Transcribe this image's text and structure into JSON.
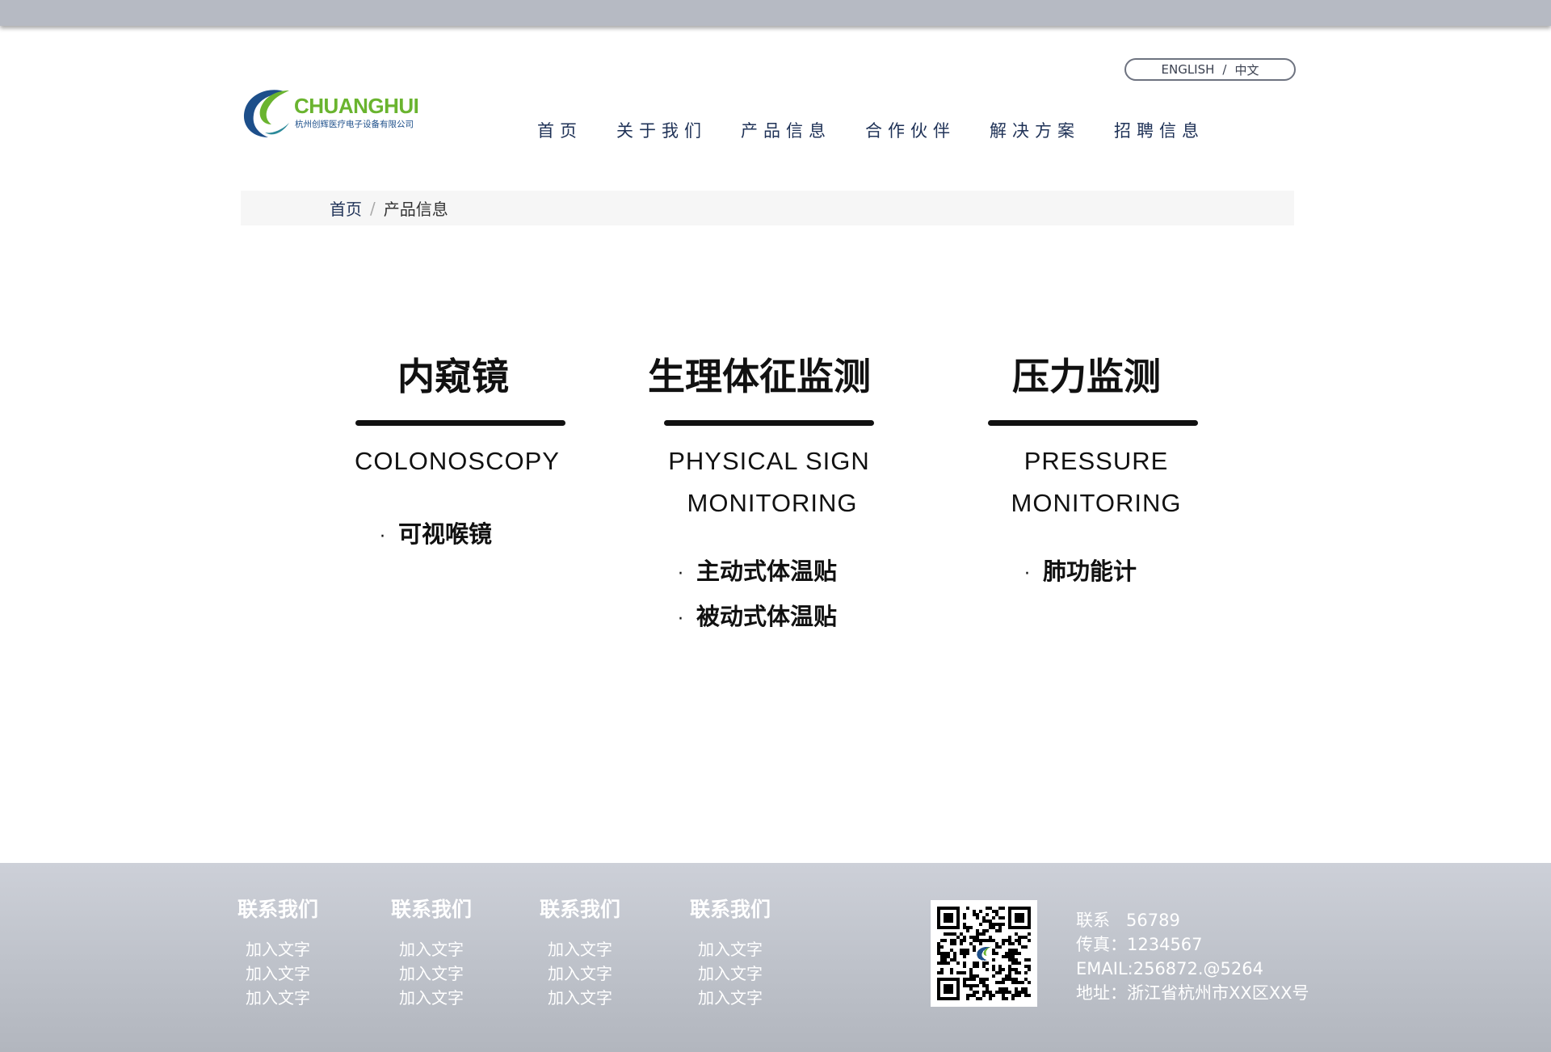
{
  "language_switch": {
    "english": "ENGLISH",
    "separator": "/",
    "chinese": "中文"
  },
  "logo": {
    "name": "CHUANGHUI",
    "company": "杭州创辉医疗电子设备有限公司",
    "colors": {
      "green": "#6ab42f",
      "blue": "#1d4f8a"
    }
  },
  "nav": {
    "items": [
      {
        "label": "首页"
      },
      {
        "label": "关于我们"
      },
      {
        "label": "产品信息"
      },
      {
        "label": "合作伙伴"
      },
      {
        "label": "解决方案"
      },
      {
        "label": "招聘信息"
      }
    ]
  },
  "breadcrumb": {
    "home": "首页",
    "separator": "/",
    "current": "产品信息"
  },
  "categories": [
    {
      "title": "内窥镜",
      "en_line1": "COLONOSCOPY",
      "en_line2": "",
      "items": [
        {
          "label": "可视喉镜"
        }
      ]
    },
    {
      "title": "生理体征监测",
      "en_line1": "PHYSICAL SIGN",
      "en_line2": "MONITORING",
      "items": [
        {
          "label": "主动式体温贴"
        },
        {
          "label": "被动式体温贴"
        }
      ]
    },
    {
      "title": "压力监测",
      "en_line1": "PRESSURE",
      "en_line2": "MONITORING",
      "items": [
        {
          "label": "肺功能计"
        }
      ]
    }
  ],
  "footer": {
    "columns": [
      {
        "heading": "联系我们",
        "links": [
          "加入文字",
          "加入文字",
          "加入文字"
        ]
      },
      {
        "heading": "联系我们",
        "links": [
          "加入文字",
          "加入文字",
          "加入文字"
        ]
      },
      {
        "heading": "联系我们",
        "links": [
          "加入文字",
          "加入文字",
          "加入文字"
        ]
      },
      {
        "heading": "联系我们",
        "links": [
          "加入文字",
          "加入文字",
          "加入文字"
        ]
      }
    ],
    "contact": {
      "phone_label": "联系",
      "phone_value": "56789",
      "fax": "传真：1234567",
      "email": "EMAIL:256872.@5264",
      "address": "地址：浙江省杭州市XX区XX号"
    }
  },
  "icons": {
    "qr": "qr-code-icon",
    "logo_mark": "logo-mark-icon"
  }
}
